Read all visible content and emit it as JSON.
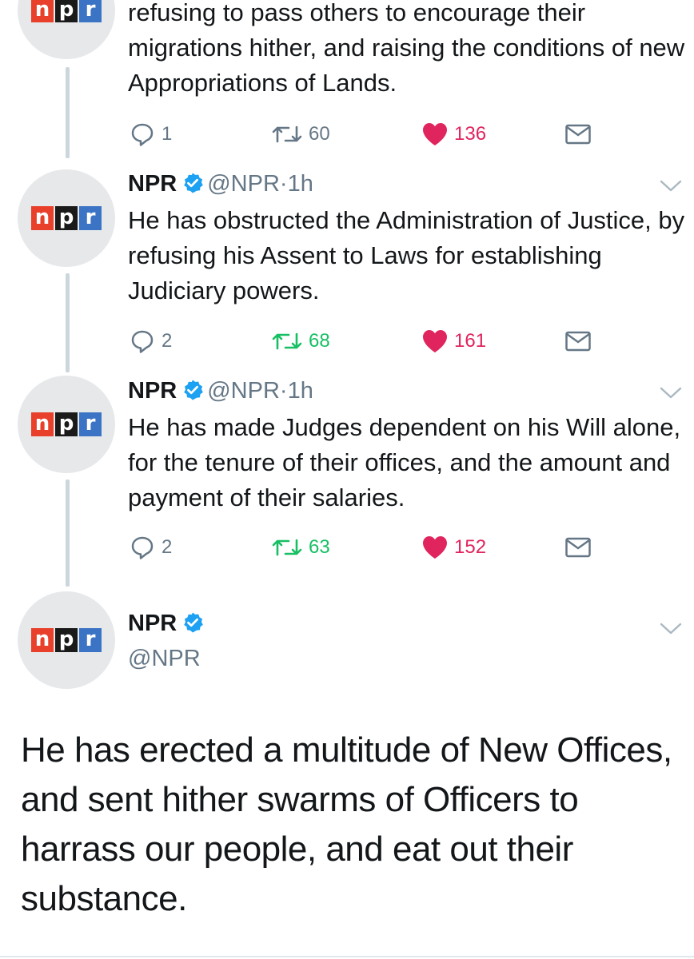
{
  "brand": {
    "logo_letters": [
      "n",
      "p",
      "r"
    ],
    "accent": "#1da1f2",
    "retweet_color": "#17bf63",
    "like_color": "#e0245e"
  },
  "tweets": [
    {
      "text": "refusing to pass others to encourage their migrations hither, and raising the conditions of new Appropriations of Lands.",
      "replies": "1",
      "retweets": "60",
      "likes": "136",
      "retweeted": false,
      "liked": true
    },
    {
      "name": "NPR",
      "handle": "@NPR",
      "separator": "·",
      "time": "1h",
      "text": "He has obstructed the Administration of Justice, by refusing his Assent to Laws for establishing Judiciary powers.",
      "replies": "2",
      "retweets": "68",
      "likes": "161",
      "retweeted": true,
      "liked": true
    },
    {
      "name": "NPR",
      "handle": "@NPR",
      "separator": "·",
      "time": "1h",
      "text": "He has made Judges dependent on his Will alone, for the tenure of their offices, and the amount and payment of their salaries.",
      "replies": "2",
      "retweets": "63",
      "likes": "152",
      "retweeted": true,
      "liked": true
    }
  ],
  "focused_tweet": {
    "name": "NPR",
    "handle": "@NPR",
    "text": "He has erected a multitude of New Offices, and sent hither swarms of Officers to harrass our people, and eat out their substance."
  }
}
